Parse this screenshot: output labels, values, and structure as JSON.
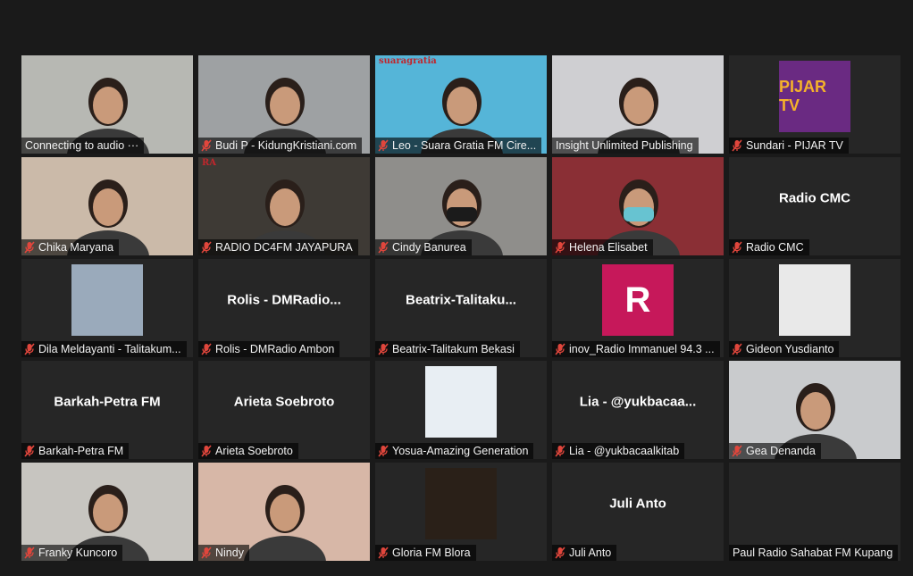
{
  "participants": [
    {
      "label": "Connecting to audio ···",
      "muted": false,
      "kind": "video",
      "bg": "#b7b8b3"
    },
    {
      "label": "Budi P - KidungKristiani.com",
      "muted": true,
      "kind": "video",
      "bg": "#9ea1a3"
    },
    {
      "label": "Leo - Suara Gratia FM Cire...",
      "muted": true,
      "kind": "video",
      "bg": "#55b5d8",
      "logo": "suaragratia"
    },
    {
      "label": "Insight Unlimited Publishing",
      "muted": false,
      "kind": "video",
      "bg": "#cfcfd2",
      "active": true
    },
    {
      "label": "Sundari - PIJAR TV",
      "muted": true,
      "kind": "thumb",
      "thumb_bg": "#6a2a82",
      "thumb_text": "PIJAR TV"
    },
    {
      "label": "Chika Maryana",
      "muted": true,
      "kind": "video",
      "bg": "#cbbaa9"
    },
    {
      "label": "RADIO DC4FM JAYAPURA",
      "muted": true,
      "kind": "video",
      "bg": "#3e3a35",
      "logo": "RA"
    },
    {
      "label": "Cindy Banurea",
      "muted": true,
      "kind": "video",
      "bg": "#8f8e8b"
    },
    {
      "label": "Helena Elisabet",
      "muted": true,
      "kind": "video",
      "bg": "#8a2f35"
    },
    {
      "label": "Radio CMC",
      "muted": true,
      "kind": "name",
      "big": "Radio CMC"
    },
    {
      "label": "Dila Meldayanti - Talitakum...",
      "muted": true,
      "kind": "thumb",
      "thumb_bg": "#9aaabb"
    },
    {
      "label": "Rolis - DMRadio Ambon",
      "muted": true,
      "kind": "name",
      "big": "Rolis  -  DMRadio..."
    },
    {
      "label": "Beatrix-Talitakum Bekasi",
      "muted": true,
      "kind": "name",
      "big": "Beatrix-Talitaku..."
    },
    {
      "label": "inov_Radio Immanuel 94.3 ...",
      "muted": true,
      "kind": "thumb",
      "thumb_bg": "#c6185a",
      "thumb_text": "R"
    },
    {
      "label": "Gideon Yusdianto",
      "muted": true,
      "kind": "thumb",
      "thumb_bg": "#e9e9e9"
    },
    {
      "label": "Barkah-Petra FM",
      "muted": true,
      "kind": "name",
      "big": "Barkah-Petra FM"
    },
    {
      "label": "Arieta Soebroto",
      "muted": true,
      "kind": "name",
      "big": "Arieta Soebroto"
    },
    {
      "label": "Yosua-Amazing Generation",
      "muted": true,
      "kind": "thumb",
      "thumb_bg": "#e8eef3"
    },
    {
      "label": "Lia - @yukbacaalkitab",
      "muted": true,
      "kind": "name",
      "big": "Lia  -  @yukbacaa..."
    },
    {
      "label": "Gea Denanda",
      "muted": true,
      "kind": "video",
      "bg": "#c9cbcd"
    },
    {
      "label": "Franky Kuncoro",
      "muted": true,
      "kind": "video",
      "bg": "#c7c5c0"
    },
    {
      "label": "Nindy",
      "muted": true,
      "kind": "video",
      "bg": "#d7b7a7"
    },
    {
      "label": "Gloria FM Blora",
      "muted": true,
      "kind": "thumb",
      "thumb_bg": "#2a2018"
    },
    {
      "label": "Juli Anto",
      "muted": true,
      "kind": "name",
      "big": "Juli Anto"
    },
    {
      "label": "Paul Radio Sahabat FM Kupang",
      "muted": false,
      "kind": "empty"
    }
  ],
  "colors": {
    "active_border": "#d8e67a",
    "muted_icon": "#e0463c",
    "tile_bg": "#262626",
    "app_bg": "#1a1a1a"
  }
}
